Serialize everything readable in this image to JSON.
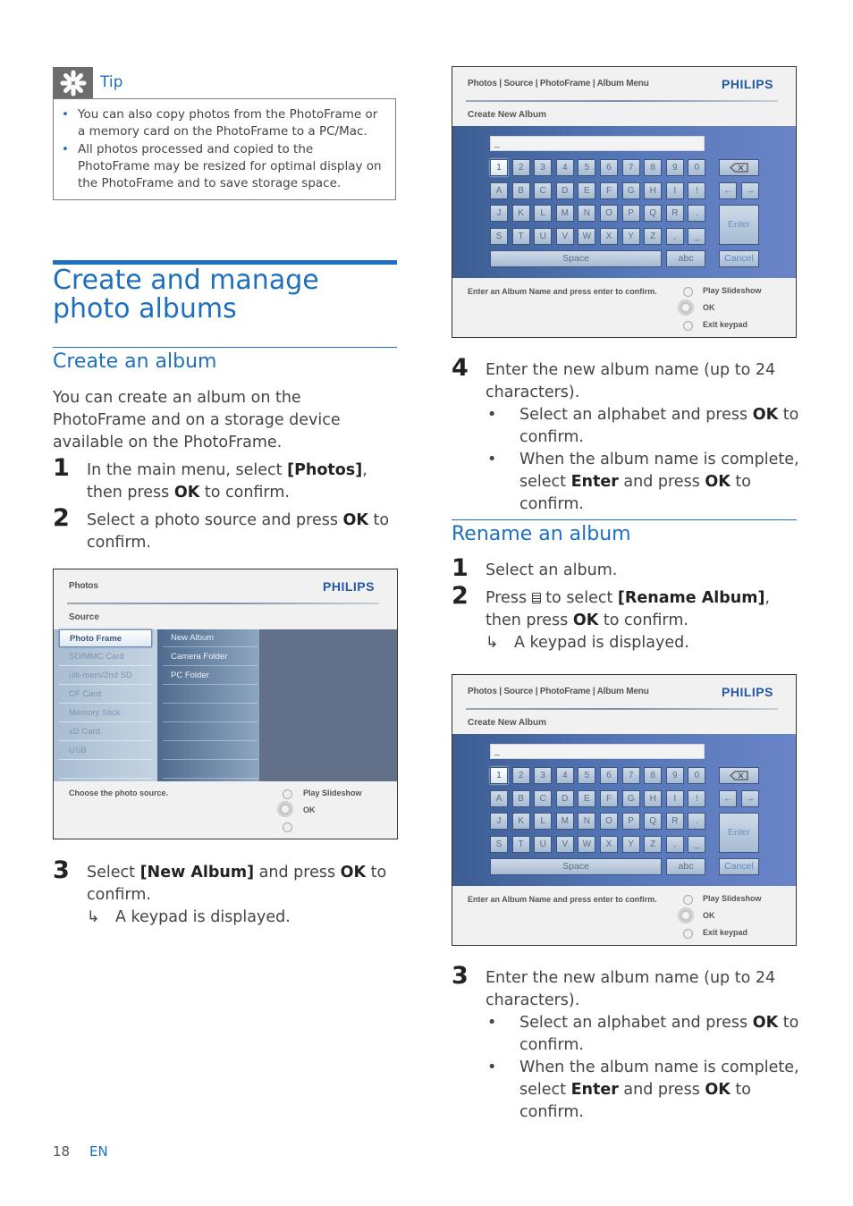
{
  "tip": {
    "icon": "asterisk-icon",
    "label": "Tip",
    "items": [
      "You can also copy photos from the PhotoFrame or a memory card on the PhotoFrame to a PC/Mac.",
      "All photos processed and copied to the PhotoFrame may be resized for optimal display on the PhotoFrame and to save storage space."
    ]
  },
  "section": {
    "title": "Create and manage photo albums"
  },
  "create_album": {
    "heading": "Create an album",
    "intro": "You can create an album on the PhotoFrame and on a storage device available on the PhotoFrame.",
    "steps": [
      {
        "num": "1",
        "pre": "In the main menu, select ",
        "bold": "[Photos]",
        "post": ", then press ",
        "bold2": "OK",
        "post2": " to confirm."
      },
      {
        "num": "2",
        "pre": "Select a photo source and press ",
        "bold": "OK",
        "post": " to confirm."
      },
      {
        "num": "3",
        "pre": "Select ",
        "bold": "[New Album]",
        "post": " and press ",
        "bold2": "OK",
        "post2": " to confirm.",
        "result": "A keypad is displayed."
      },
      {
        "num": "4",
        "text": "Enter the new album name (up to 24 characters).",
        "bullets": [
          {
            "pre": "Select an alphabet and press ",
            "bold": "OK",
            "post": " to confirm."
          },
          {
            "pre": "When the album name is complete, select ",
            "bold": "Enter",
            "post": " and press ",
            "bold2": "OK",
            "post2": " to confirm."
          }
        ]
      }
    ]
  },
  "rename_album": {
    "heading": "Rename an album",
    "steps": [
      {
        "num": "1",
        "text": "Select an album."
      },
      {
        "num": "2",
        "pre": "Press ",
        "icon": "menu-icon",
        "mid": " to select ",
        "bold": "[Rename Album]",
        "post": ", then press ",
        "bold2": "OK",
        "post2": " to confirm.",
        "result": "A keypad is displayed."
      },
      {
        "num": "3",
        "text": "Enter the new album name (up to 24 characters).",
        "bullets": [
          {
            "pre": "Select an alphabet and press ",
            "bold": "OK",
            "post": " to confirm."
          },
          {
            "pre": "When the album name is complete, select ",
            "bold": "Enter",
            "post": " and press ",
            "bold2": "OK",
            "post2": " to confirm."
          }
        ]
      }
    ]
  },
  "source_screen": {
    "breadcrumb": "Photos",
    "brand": "PHILIPS",
    "subtitle": "Source",
    "sources": [
      "Photo Frame",
      "SD/MMC Card",
      "ulti-mem/2nd SD",
      "CF Card",
      "Memory Stick",
      "xD Card",
      "USB"
    ],
    "selected_source": "Photo Frame",
    "folders": [
      "New Album",
      "Camera Folder",
      "PC Folder"
    ],
    "footer_hint": "Choose the photo source.",
    "nav": {
      "up": "Play Slideshow",
      "center": "OK",
      "down": ""
    }
  },
  "keypad_screen": {
    "breadcrumb": "Photos | Source | PhotoFrame | Album Menu",
    "brand": "PHILIPS",
    "subtitle": "Create New Album",
    "input_value": "_",
    "rows": [
      [
        "1",
        "2",
        "3",
        "4",
        "5",
        "6",
        "7",
        "8",
        "9",
        "0"
      ],
      [
        "A",
        "B",
        "C",
        "D",
        "E",
        "F",
        "G",
        "H",
        "I",
        "!"
      ],
      [
        "J",
        "K",
        "L",
        "M",
        "N",
        "O",
        "P",
        "Q",
        "R",
        "."
      ],
      [
        "S",
        "T",
        "U",
        "V",
        "W",
        "X",
        "Y",
        "Z",
        ",",
        "_"
      ]
    ],
    "highlighted_key": "1",
    "backspace_icon": "backspace-icon",
    "left_arrow": "←",
    "right_arrow": "→",
    "enter": "Enter",
    "space": "Space",
    "abc": "abc",
    "cancel": "Cancel",
    "footer_hint": "Enter an Album Name and press enter to confirm.",
    "nav": {
      "up": "Play Slideshow",
      "center": "OK",
      "down": "Exit keypad"
    }
  },
  "footer": {
    "page_number": "18",
    "language": "EN"
  }
}
